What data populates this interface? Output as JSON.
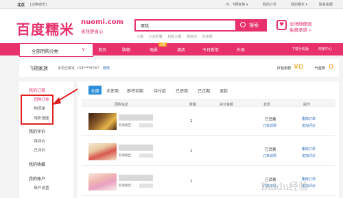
{
  "topbar": {
    "city": "北京",
    "switch_city": "[切换城市]",
    "greeting": "Hi, 飞翔家族 ▾",
    "links": [
      "我的订单",
      "我的糯米 ▾",
      "联系客服"
    ]
  },
  "header": {
    "logo": "百度糯米",
    "logo_en": "nuomi.com",
    "slogan": "省钱更省心",
    "search_value": "蛋糕",
    "search_button": "搜索",
    "hot_words": [
      "火锅",
      "小龙虾餐",
      "自助大餐",
      "微信坊",
      "东来顺"
    ],
    "promo_line1": "全场随便退",
    "promo_line2": "免费承诺 »"
  },
  "nav": {
    "category_label": "全部团购分类",
    "items": [
      "首页",
      "购物",
      "电影",
      "酒店",
      "今日新单",
      "外卖"
    ],
    "badge": "订座",
    "right_items": [
      "下载手机版",
      "商家中心"
    ]
  },
  "user": {
    "name": "飞翔家族",
    "phone_label": "手机已绑定",
    "phone": "158****8787",
    "modify": "修改",
    "redbag_label": "红包余额",
    "redbag_amount": "¥0",
    "voucher_label": "代金券",
    "voucher_amount": "0"
  },
  "sidebar": {
    "sections": [
      {
        "title": "我的订单",
        "items": [
          "· 团购订单",
          "· 物流单",
          "· 电影选座"
        ]
      },
      {
        "title": "我的评价",
        "items": [
          "· 待评价",
          "· 已评价"
        ]
      },
      {
        "title": "我的收藏",
        "items": []
      },
      {
        "title": "我的账户",
        "items": [
          "· 账户设置"
        ]
      }
    ]
  },
  "orders": {
    "tabs": [
      "全部",
      "未使用",
      "即将到期",
      "待付款",
      "已使用",
      "已过期",
      "退款"
    ],
    "headers": [
      "团购信息",
      "数量",
      "实付金额",
      "状态",
      "操作"
    ],
    "rows": [
      {
        "expiry": "有效期至：",
        "qty": "1",
        "status": "已消费",
        "status_link": "订单详情",
        "op1": "删除订单",
        "op2": "追加评价"
      },
      {
        "expiry": "有效期至：",
        "qty": "1",
        "status": "已消费",
        "status_link": "订单详情",
        "op1": "删除订单",
        "op2": "追加评价"
      },
      {
        "expiry": "有效期至：",
        "qty": "1",
        "status": "已消费",
        "status_link": "订单详情",
        "op1": "删除订单",
        "op2": "追加评价"
      }
    ]
  },
  "watermark": "Baidu经验",
  "colors": {
    "brand": "#e8306b",
    "tab_active": "#2a8fd8",
    "highlight_box": "#e02020",
    "link": "#2a6ebb",
    "amount": "#f5a623"
  }
}
